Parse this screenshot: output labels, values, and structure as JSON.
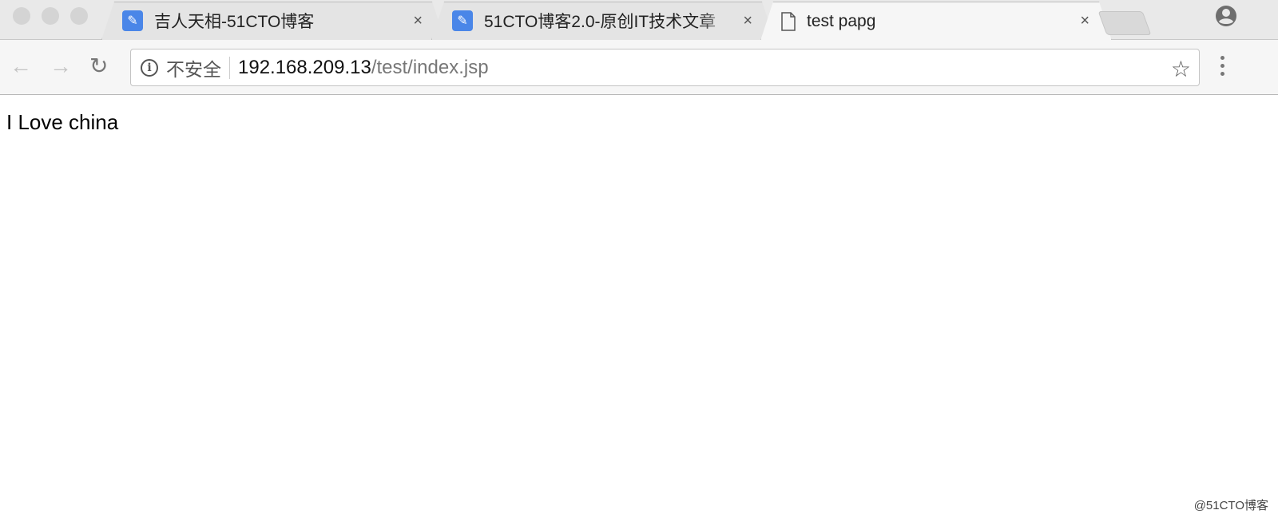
{
  "tabs": [
    {
      "title": "吉人天相-51CTO博客",
      "icon": "feather-favicon",
      "active": false
    },
    {
      "title": "51CTO博客2.0-原创IT技术文章",
      "icon": "feather-favicon",
      "active": false
    },
    {
      "title": "test papg",
      "icon": "document-icon",
      "active": true
    }
  ],
  "tab_close": "×",
  "omnibox": {
    "security_label": "不安全",
    "host": "192.168.209.13",
    "path": "/test/index.jsp"
  },
  "page": {
    "text": "I Love china"
  },
  "watermark": "@51CTO博客",
  "colors": {
    "favicon": "#4a86e8"
  }
}
